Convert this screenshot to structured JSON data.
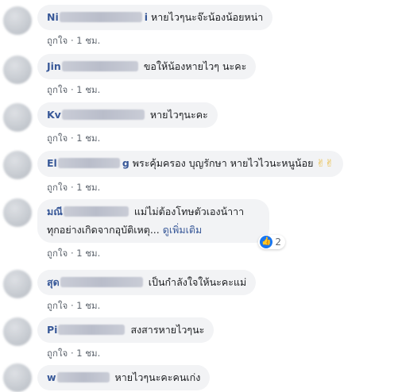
{
  "comments": [
    {
      "name_visible": "Ni",
      "name_tail": "i",
      "text": "หายไวๆนะจ๊ะน้องน้อยหน่า",
      "like": "ถูกใจ",
      "time": "1 ชม."
    },
    {
      "name_visible": "Jin",
      "name_tail": "",
      "text": "ขอให้น้องหายไวๆ นะคะ",
      "like": "ถูกใจ",
      "time": "1 ชม."
    },
    {
      "name_visible": "Kv",
      "name_tail": "",
      "text": "หายไวๆนะคะ",
      "like": "ถูกใจ",
      "time": "1 ชม."
    },
    {
      "name_visible": "El",
      "name_tail": "g",
      "text": "พระคุ้มครอง บุญรักษา หายไวไวนะหนูน้อย",
      "emoji": "✌✌",
      "like": "ถูกใจ",
      "time": "1 ชม."
    },
    {
      "name_visible": "มณี",
      "name_tail": "",
      "text": "แม่ไม่ต้องโทษตัวเองน้าาา",
      "text2": "ทุกอย่างเกิดจากอุบัติเหตุ...",
      "see_more": "ดูเพิ่มเติม",
      "reaction_count": "2",
      "like": "ถูกใจ",
      "time": "1 ชม."
    },
    {
      "name_visible": "สุด",
      "name_tail": "",
      "text": "เป็นกำลังใจให้นะคะแม่",
      "like": "ถูกใจ",
      "time": "1 ชม."
    },
    {
      "name_visible": "Pi",
      "name_tail": "",
      "text": "สงสารหายไวๆนะ",
      "like": "ถูกใจ",
      "time": "1 ชม."
    },
    {
      "name_visible": "w",
      "name_tail": "",
      "text": "หายไวๆนะคะคนเก่ง",
      "like": "",
      "time": ""
    }
  ],
  "meta_separator": "·",
  "icons": {
    "reaction": "like-icon"
  }
}
